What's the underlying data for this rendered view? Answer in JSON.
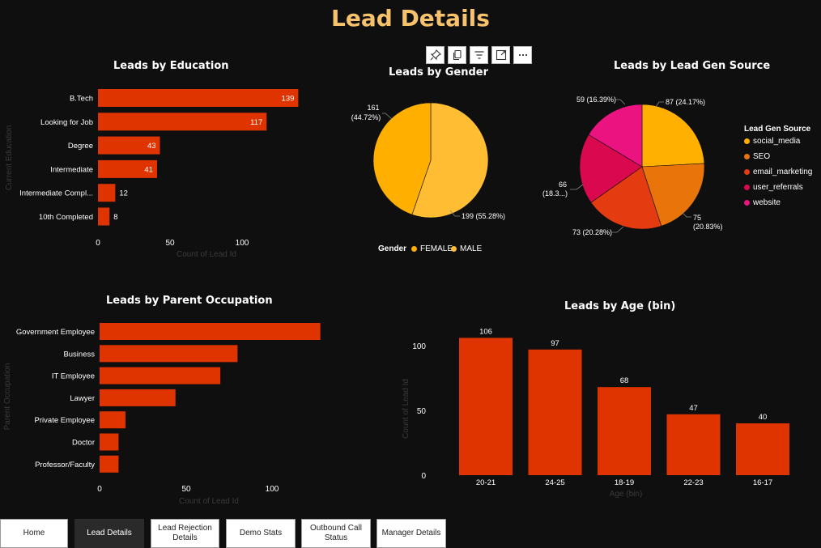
{
  "page": {
    "title": "Lead Details"
  },
  "colors": {
    "bar": "#e03400",
    "pie_female": "#ffaf00",
    "pie_male": "#ffbd33",
    "social_media": "#ffb000",
    "seo": "#e8740a",
    "email_marketing": "#e53b11",
    "user_referrals": "#d9084f",
    "website": "#ea1380"
  },
  "toolbar": {
    "icons": [
      "pin-icon",
      "copy-icon",
      "filter-icon",
      "focus-mode-icon",
      "more-options-icon"
    ]
  },
  "charts": {
    "education": {
      "title": "Leads by Education",
      "ylabel": "Current Education",
      "xlabel": "Count of Lead Id",
      "ticks": [
        "0",
        "50",
        "100"
      ]
    },
    "gender": {
      "title": "Leads by Gender",
      "legend_title": "Gender",
      "legend": [
        "FEMALE",
        "MALE"
      ],
      "labels": [
        "161",
        "(44.72%)",
        "199 (55.28%)"
      ]
    },
    "source": {
      "title": "Leads by Lead Gen Source",
      "legend_title": "Lead Gen Source",
      "legend": [
        "social_media",
        "SEO",
        "email_marketing",
        "user_referrals",
        "website"
      ],
      "labels": [
        "87 (24.17%)",
        "75",
        "(20.83%)",
        "73 (20.28%)",
        "66",
        "(18.3...)",
        "59 (16.39%)"
      ]
    },
    "parent": {
      "title": "Leads by Parent Occupation",
      "ylabel": "Parent Occupation",
      "xlabel": "Count of Lead Id",
      "ticks": [
        "0",
        "50",
        "100"
      ]
    },
    "age": {
      "title": "Leads by Age (bin)",
      "ylabel": "Count of Lead Id",
      "xlabel": "Age (bin)",
      "ticks": [
        "0",
        "50",
        "100"
      ]
    }
  },
  "chart_data": [
    {
      "type": "bar",
      "orientation": "horizontal",
      "title": "Leads by Education",
      "categories": [
        "B.Tech",
        "Looking for Job",
        "Degree",
        "Intermediate",
        "Intermediate Compl...",
        "10th Completed"
      ],
      "values": [
        139,
        117,
        43,
        41,
        12,
        8
      ],
      "xlabel": "Count of Lead Id",
      "ylabel": "Current Education",
      "xlim": [
        0,
        150
      ]
    },
    {
      "type": "pie",
      "title": "Leads by Gender",
      "categories": [
        "FEMALE",
        "MALE"
      ],
      "values": [
        161,
        199
      ],
      "percent": [
        44.72,
        55.28
      ]
    },
    {
      "type": "pie",
      "title": "Leads by Lead Gen Source",
      "categories": [
        "social_media",
        "SEO",
        "email_marketing",
        "user_referrals",
        "website"
      ],
      "values": [
        87,
        75,
        73,
        66,
        59
      ],
      "percent": [
        24.17,
        20.83,
        20.28,
        18.33,
        16.39
      ]
    },
    {
      "type": "bar",
      "orientation": "horizontal",
      "title": "Leads by Parent Occupation",
      "categories": [
        "Government Employee",
        "Business",
        "IT Employee",
        "Lawyer",
        "Private Employee",
        "Doctor",
        "Professor/Faculty"
      ],
      "values": [
        128,
        80,
        70,
        44,
        15,
        11,
        11
      ],
      "xlabel": "Count of Lead Id",
      "ylabel": "Parent Occupation",
      "xlim": [
        0,
        130
      ]
    },
    {
      "type": "bar",
      "title": "Leads by Age (bin)",
      "categories": [
        "20-21",
        "24-25",
        "18-19",
        "22-23",
        "16-17"
      ],
      "values": [
        106,
        97,
        68,
        47,
        40
      ],
      "xlabel": "Age (bin)",
      "ylabel": "Count of Lead Id",
      "ylim": [
        0,
        120
      ]
    }
  ],
  "nav": {
    "home": "Home",
    "lead_details": "Lead Details",
    "lead_rejection_1": "Lead Rejection",
    "lead_rejection_2": "Details",
    "demo_stats": "Demo Stats",
    "outbound_1": "Outbound Call",
    "outbound_2": "Status",
    "manager_details": "Manager Details"
  }
}
